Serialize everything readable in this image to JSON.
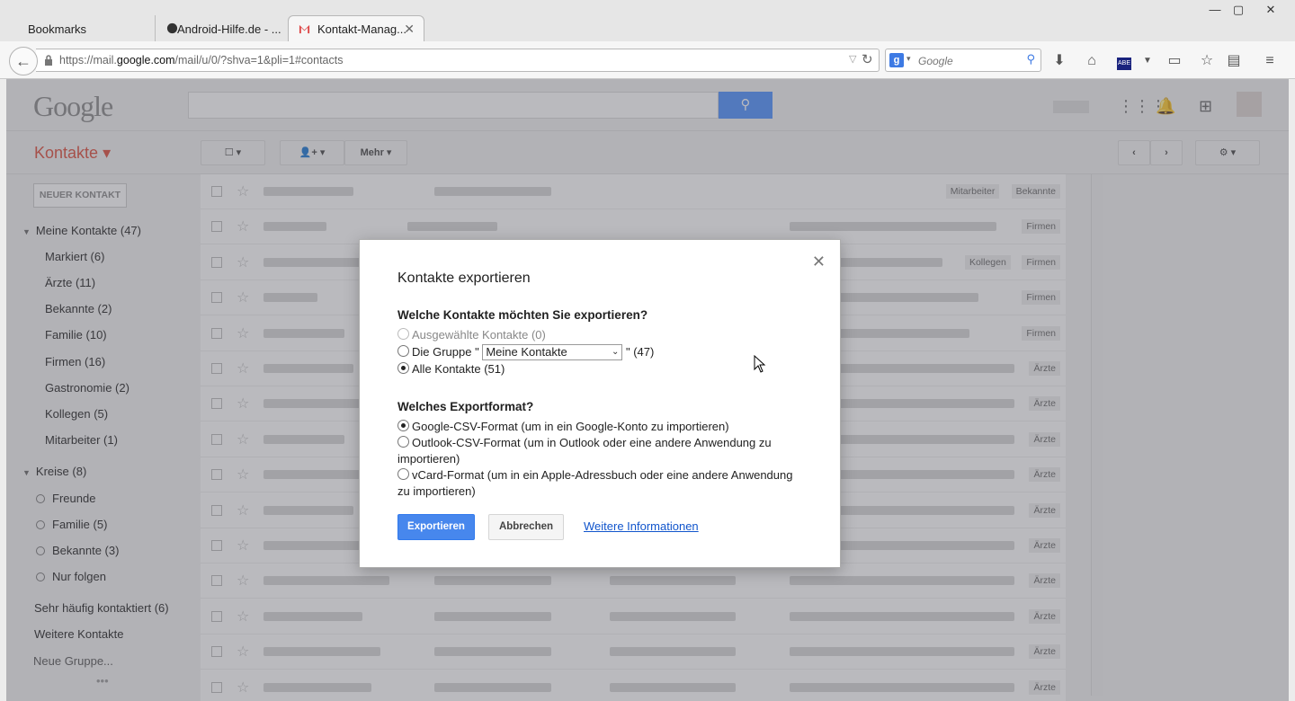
{
  "browser": {
    "tabs": [
      {
        "label": "Bookmarks"
      },
      {
        "label": "Android-Hilfe.de - ..."
      },
      {
        "label": "Kontakt-Manag..."
      }
    ],
    "url_prefix": "https://mail.",
    "url_domain": "google.com",
    "url_suffix": "/mail/u/0/?shva=1&pli=1#contacts",
    "search_placeholder": "Google"
  },
  "app": {
    "logo": "Google",
    "section_title": "Kontakte",
    "more_button": "Mehr",
    "new_contact_button": "NEUER KONTAKT",
    "sidebar": {
      "my_contacts": "Meine Kontakte (47)",
      "groups": [
        "Markiert (6)",
        "Ärzte (11)",
        "Bekannte (2)",
        "Familie (10)",
        "Firmen (16)",
        "Gastronomie (2)",
        "Kollegen (5)",
        "Mitarbeiter (1)"
      ],
      "circles_header": "Kreise (8)",
      "circles": [
        "Freunde",
        "Familie (5)",
        "Bekannte (3)",
        "Nur folgen"
      ],
      "frequent": "Sehr häufig kontaktiert (6)",
      "other": "Weitere Kontakte",
      "new_group": "Neue Gruppe..."
    },
    "row_labels": [
      [
        "Mitarbeiter",
        "Bekannte"
      ],
      [
        "Firmen"
      ],
      [
        "Kollegen",
        "Firmen"
      ],
      [
        "Firmen"
      ],
      [
        "Firmen"
      ],
      [
        "Ärzte"
      ],
      [
        "Ärzte"
      ],
      [
        "Ärzte"
      ],
      [
        "Ärzte"
      ],
      [
        "Ärzte"
      ],
      [
        "Ärzte"
      ],
      [
        "Ärzte"
      ],
      [
        "Ärzte"
      ],
      [
        "Ärzte"
      ],
      [
        "Ärzte"
      ]
    ]
  },
  "dialog": {
    "title": "Kontakte exportieren",
    "question1": "Welche Kontakte möchten Sie exportieren?",
    "opt_selected": "Ausgewählte Kontakte (0)",
    "opt_group_prefix": "Die Gruppe \"",
    "group_value": "Meine Kontakte",
    "opt_group_suffix": "\" (47)",
    "opt_all": "Alle Kontakte (51)",
    "question2": "Welches Exportformat?",
    "fmt_google": "Google-CSV-Format (um in ein Google-Konto zu importieren)",
    "fmt_outlook_1": "Outlook-CSV-Format (um in Outlook oder eine andere Anwendung zu",
    "fmt_outlook_2": "importieren)",
    "fmt_vcard_1": "vCard-Format (um in ein Apple-Adressbuch oder eine andere Anwendung",
    "fmt_vcard_2": "zu importieren)",
    "export_button": "Exportieren",
    "cancel_button": "Abbrechen",
    "more_info_link": "Weitere Informationen"
  }
}
